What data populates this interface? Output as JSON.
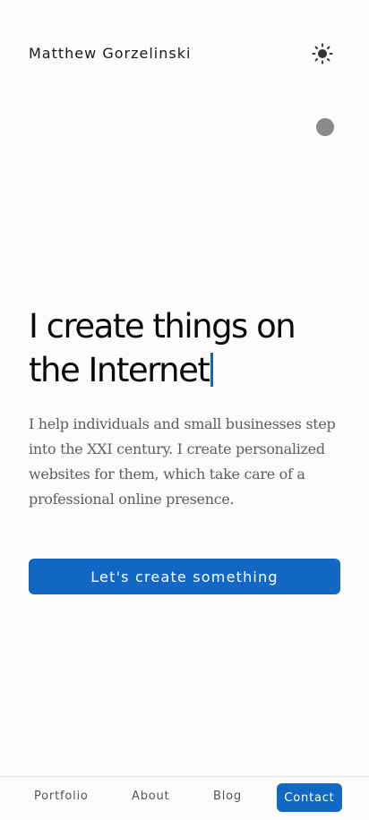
{
  "header": {
    "brand": "Matthew Gorzelinski",
    "theme_icon": "sun-icon"
  },
  "decor": {
    "dot_color": "#8a8a8a"
  },
  "hero": {
    "title": "I create things on the Internet",
    "description": "I help individuals and small businesses step into the XXI century. I create personalized websites for them, which take care of a professional online presence.",
    "cta_label": "Let's create something"
  },
  "nav": {
    "items": [
      {
        "label": "Portfolio"
      },
      {
        "label": "About"
      },
      {
        "label": "Blog"
      }
    ],
    "contact_label": "Contact"
  },
  "colors": {
    "accent": "#1268c4",
    "background": "#fdfcfa",
    "text_muted": "#5e5e5e"
  }
}
